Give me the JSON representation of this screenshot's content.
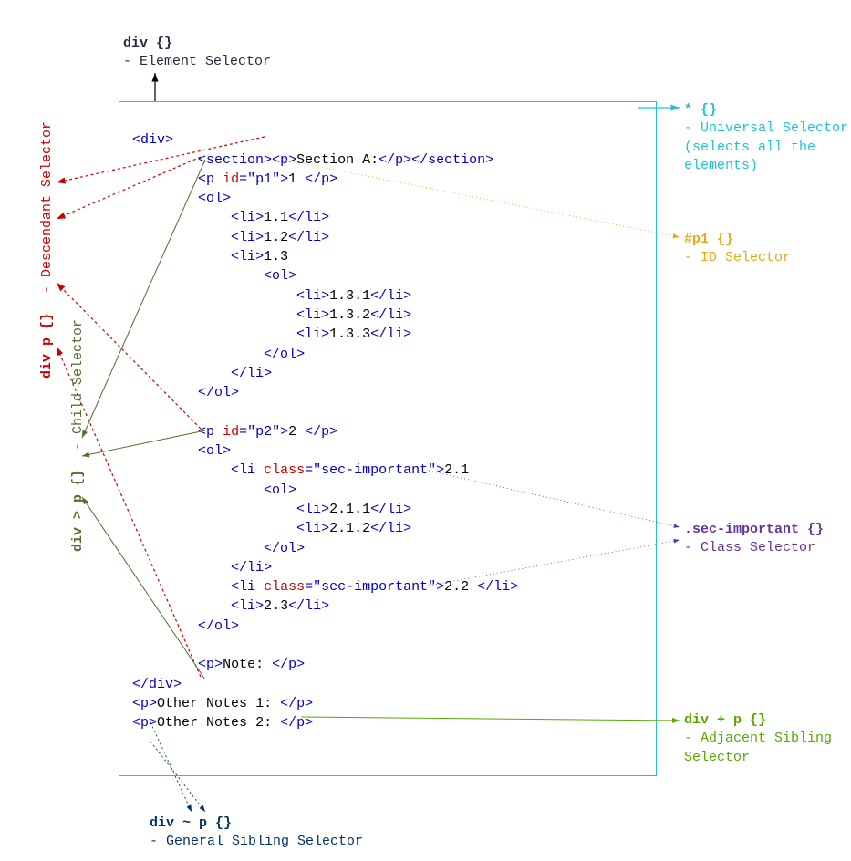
{
  "annotations": {
    "element": {
      "title": "div {}",
      "sub": "- Element Selector"
    },
    "universal": {
      "title": "* {}",
      "sub1": "- Universal Selector",
      "sub2": "(selects all the",
      "sub3": "elements)"
    },
    "id": {
      "title": "#p1 {}",
      "sub": "- ID Selector"
    },
    "descendant": {
      "title": "div p {}",
      "sub": "- Descendant Selector"
    },
    "child": {
      "title": "div > p {}",
      "sub": "- Child Selector"
    },
    "class": {
      "title": ".sec-important {}",
      "sub": "- Class Selector"
    },
    "adjacent": {
      "title": "div + p {}",
      "sub1": "- Adjacent Sibling",
      "sub2": "  Selector"
    },
    "general": {
      "title": "div ~ p {}",
      "sub": "- General Sibling Selector"
    }
  },
  "code": {
    "div_open": "div",
    "div_close": "div",
    "section_open": "section",
    "section_close": "section",
    "p": "p",
    "ol": "ol",
    "li": "li",
    "id_attr": "id",
    "class_attr": "class",
    "p1_val": "\"p1\"",
    "p2_val": "\"p2\"",
    "sec_val": "\"sec-important\"",
    "section_a": "Section A:",
    "t1": "1 ",
    "t11": "1.1",
    "t12": "1.2",
    "t13": "1.3",
    "t131": "1.3.1",
    "t132": "1.3.2",
    "t133": "1.3.3",
    "t2": "2 ",
    "t21": "2.1",
    "t211": "2.1.1",
    "t212": "2.1.2",
    "t22": "2.2 ",
    "t23": "2.3",
    "note": "Note: ",
    "other1": "Other Notes 1: ",
    "other2": "Other Notes 2: "
  }
}
